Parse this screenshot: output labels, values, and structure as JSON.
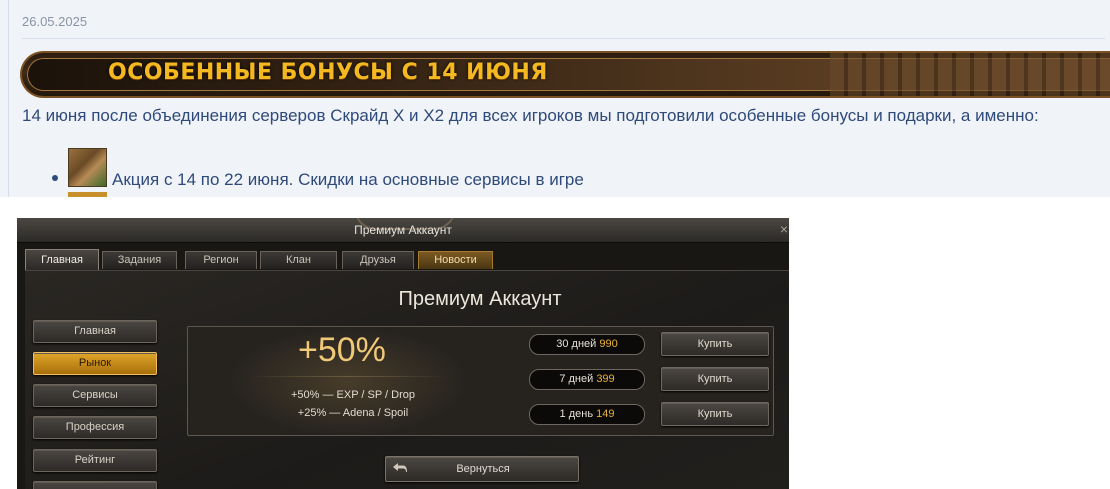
{
  "post": {
    "date": "26.05.2025",
    "banner_title": "ОСОБЕННЫЕ БОНУСЫ С 14 ИЮНЯ",
    "text": "14 июня после объединения серверов Скрайд X и X2 для всех игроков мы подготовили особенные бонусы и подарки, а именно:",
    "list": [
      {
        "text": "Акция с 14 по 22 июня. Скидки на основные сервисы в игре"
      }
    ]
  },
  "game": {
    "window_title": "Премиум Аккаунт",
    "close_glyph": "×",
    "tabs": [
      "Главная",
      "Задания",
      "Регион",
      "Клан",
      "Друзья",
      "Новости"
    ],
    "sidebar": [
      "Главная",
      "Рынок",
      "Сервисы",
      "Профессия",
      "Рейтинг"
    ],
    "screen_title": "Премиум Аккаунт",
    "bonus": {
      "percent": "+50%",
      "line1": "+50% — EXP / SP / Drop",
      "line2": "+25% — Adena / Spoil"
    },
    "options": [
      {
        "duration": "30 дней",
        "price": "990",
        "buy": "Купить"
      },
      {
        "duration": "7 дней",
        "price": "399",
        "buy": "Купить"
      },
      {
        "duration": "1 день",
        "price": "149",
        "buy": "Купить"
      }
    ],
    "back_label": "Вернуться",
    "colors": {
      "accent_gold": "#e8b33a",
      "active_tab_gold": "#a8700c",
      "bg_dark": "#191714"
    }
  }
}
